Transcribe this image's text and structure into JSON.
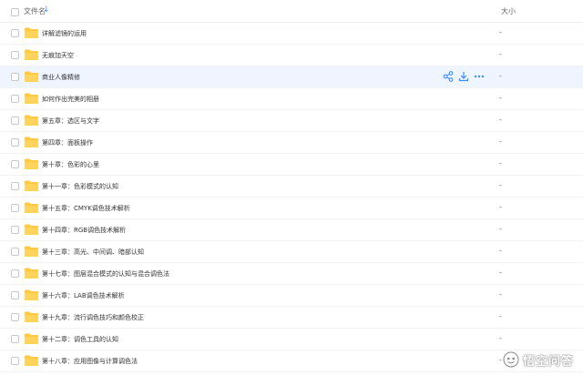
{
  "header": {
    "name_label": "文件名",
    "sort_icon": "↓",
    "size_label": "大小"
  },
  "colors": {
    "accent": "#3b8cff",
    "folder": "#ffc940",
    "hover_row": "#eef5ff"
  },
  "rows": [
    {
      "name": "详解滤镜的运用",
      "size": "-"
    },
    {
      "name": "无痕加天空",
      "size": "-"
    },
    {
      "name": "商业人像精修",
      "size": "-"
    },
    {
      "name": "如何作出完美的相册",
      "size": "-"
    },
    {
      "name": "第五章：选区与文字",
      "size": "-"
    },
    {
      "name": "第四章：面板操作",
      "size": "-"
    },
    {
      "name": "第十章：色彩的心里",
      "size": "-"
    },
    {
      "name": "第十一章：色彩模式的认知",
      "size": "-"
    },
    {
      "name": "第十五章：CMYK调色技术解析",
      "size": "-"
    },
    {
      "name": "第十四章：RGB调色技术解析",
      "size": "-"
    },
    {
      "name": "第十三章：高光、中间调、暗部认知",
      "size": "-"
    },
    {
      "name": "第十七章：图层混合模式的认知与混合调色法",
      "size": "-"
    },
    {
      "name": "第十六章：LAB调色技术解析",
      "size": "-"
    },
    {
      "name": "第十九章：流行调色技巧和颜色校正",
      "size": "-"
    },
    {
      "name": "第十二章：调色工具的认知",
      "size": "-"
    },
    {
      "name": "第十八章：应用图像与计算调色法",
      "size": "-"
    }
  ],
  "watermark": {
    "text": "悟空问答"
  }
}
